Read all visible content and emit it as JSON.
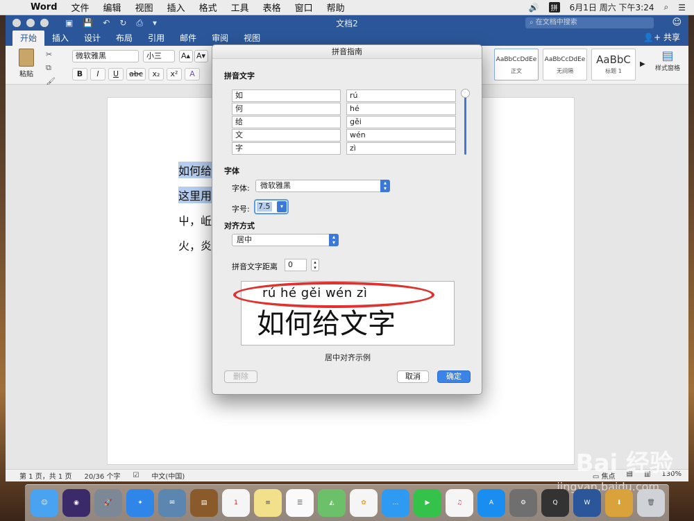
{
  "menubar": {
    "app": "Word",
    "items": [
      "文件",
      "编辑",
      "视图",
      "插入",
      "格式",
      "工具",
      "表格",
      "窗口",
      "帮助"
    ],
    "input_method": "拼",
    "clock": "6月1日 周六 下午3:24"
  },
  "window": {
    "doc_title": "文档2",
    "search_placeholder": "在文档中搜索",
    "share": "共享",
    "tabs": [
      "开始",
      "插入",
      "设计",
      "布局",
      "引用",
      "邮件",
      "审阅",
      "视图"
    ],
    "active_tab": "开始"
  },
  "ribbon": {
    "paste": "粘贴",
    "font_name": "微软雅黑",
    "font_size": "小三",
    "styles": [
      {
        "preview": "AaBbCcDdEe",
        "name": "正文"
      },
      {
        "preview": "AaBbCcDdEe",
        "name": "无间隔"
      },
      {
        "preview": "AaBbC",
        "name": "标题 1"
      }
    ],
    "style_pane": "样式窗格"
  },
  "document": {
    "lines": [
      "如何给",
      "这里用",
      "屮，岴",
      "火，炎"
    ]
  },
  "status": {
    "page": "第 1 页，共 1 页",
    "words": "20/36 个字",
    "language": "中文(中国)",
    "focus": "焦点",
    "zoom": "130%"
  },
  "dialog": {
    "title": "拼音指南",
    "section_text": "拼音文字",
    "rows": [
      {
        "base": "如",
        "ruby": "rú"
      },
      {
        "base": "何",
        "ruby": "hé"
      },
      {
        "base": "给",
        "ruby": "gěi"
      },
      {
        "base": "文",
        "ruby": "wén"
      },
      {
        "base": "字",
        "ruby": "zì"
      }
    ],
    "section_font": "字体",
    "font_label": "字体:",
    "font_value": "微软雅黑",
    "size_label": "字号:",
    "size_value": "7.5",
    "section_align": "对齐方式",
    "align_value": "居中",
    "offset_label": "拼音文字距离",
    "offset_value": "0",
    "preview_pinyin": "rú  hé  gěi wén  zì",
    "preview_chars": "如何给文字",
    "caption": "居中对齐示例",
    "btn_delete": "删除",
    "btn_cancel": "取消",
    "btn_ok": "确定"
  },
  "watermark": {
    "brand": "Bai 经验",
    "url": "jingyan.baidu.com"
  }
}
